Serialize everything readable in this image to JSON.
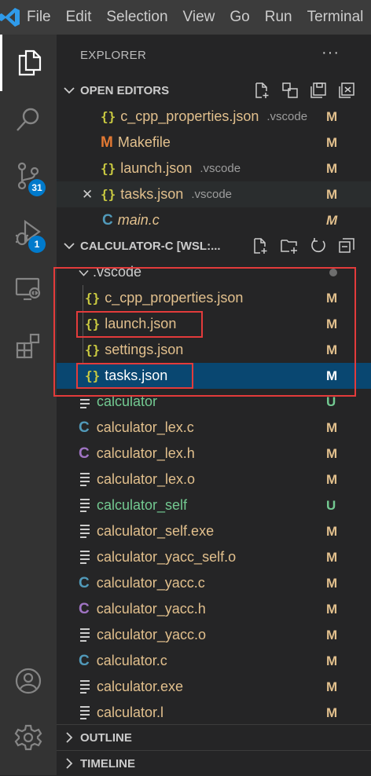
{
  "menubar": {
    "items": [
      "File",
      "Edit",
      "Selection",
      "View",
      "Go",
      "Run",
      "Terminal"
    ]
  },
  "activity": {
    "scm_badge": "31",
    "debug_badge": "1"
  },
  "explorer": {
    "title": "EXPLORER",
    "more": "···"
  },
  "open_editors": {
    "title": "OPEN EDITORS",
    "items": [
      {
        "name": "c_cpp_properties.json",
        "desc": ".vscode",
        "status": "M",
        "icon": "json-icon"
      },
      {
        "name": "Makefile",
        "desc": "",
        "status": "M",
        "icon": "makefile-icon"
      },
      {
        "name": "launch.json",
        "desc": ".vscode",
        "status": "M",
        "icon": "json-icon"
      },
      {
        "name": "tasks.json",
        "desc": ".vscode",
        "status": "M",
        "icon": "json-icon"
      },
      {
        "name": "main.c",
        "desc": "",
        "status": "M",
        "icon": "c-icon"
      }
    ]
  },
  "workspace": {
    "title": "CALCULATOR-C [WSL:...",
    "folder": ".vscode",
    "folder_children": [
      {
        "name": "c_cpp_properties.json",
        "status": "M"
      },
      {
        "name": "launch.json",
        "status": "M"
      },
      {
        "name": "settings.json",
        "status": "M"
      },
      {
        "name": "tasks.json",
        "status": "M"
      }
    ],
    "files": [
      {
        "name": "calculator",
        "status": "U",
        "icon": "file-icon"
      },
      {
        "name": "calculator_lex.c",
        "status": "M",
        "icon": "c-icon"
      },
      {
        "name": "calculator_lex.h",
        "status": "M",
        "icon": "h-icon"
      },
      {
        "name": "calculator_lex.o",
        "status": "M",
        "icon": "file-icon"
      },
      {
        "name": "calculator_self",
        "status": "U",
        "icon": "file-icon"
      },
      {
        "name": "calculator_self.exe",
        "status": "M",
        "icon": "file-icon"
      },
      {
        "name": "calculator_yacc_self.o",
        "status": "M",
        "icon": "file-icon"
      },
      {
        "name": "calculator_yacc.c",
        "status": "M",
        "icon": "c-icon"
      },
      {
        "name": "calculator_yacc.h",
        "status": "M",
        "icon": "h-icon"
      },
      {
        "name": "calculator_yacc.o",
        "status": "M",
        "icon": "file-icon"
      },
      {
        "name": "calculator.c",
        "status": "M",
        "icon": "c-icon"
      },
      {
        "name": "calculator.exe",
        "status": "M",
        "icon": "file-icon"
      },
      {
        "name": "calculator.l",
        "status": "M",
        "icon": "file-icon"
      }
    ]
  },
  "outline": {
    "title": "OUTLINE"
  },
  "timeline": {
    "title": "TIMELINE"
  },
  "icon_glyphs": {
    "json": "{}",
    "c": "C",
    "makefile": "M",
    "close": "✕"
  },
  "colors": {
    "modified": "#e2c08d",
    "untracked": "#73c991",
    "accent": "#007acc",
    "selection": "#094771",
    "highlight_box": "#e33b3b"
  }
}
